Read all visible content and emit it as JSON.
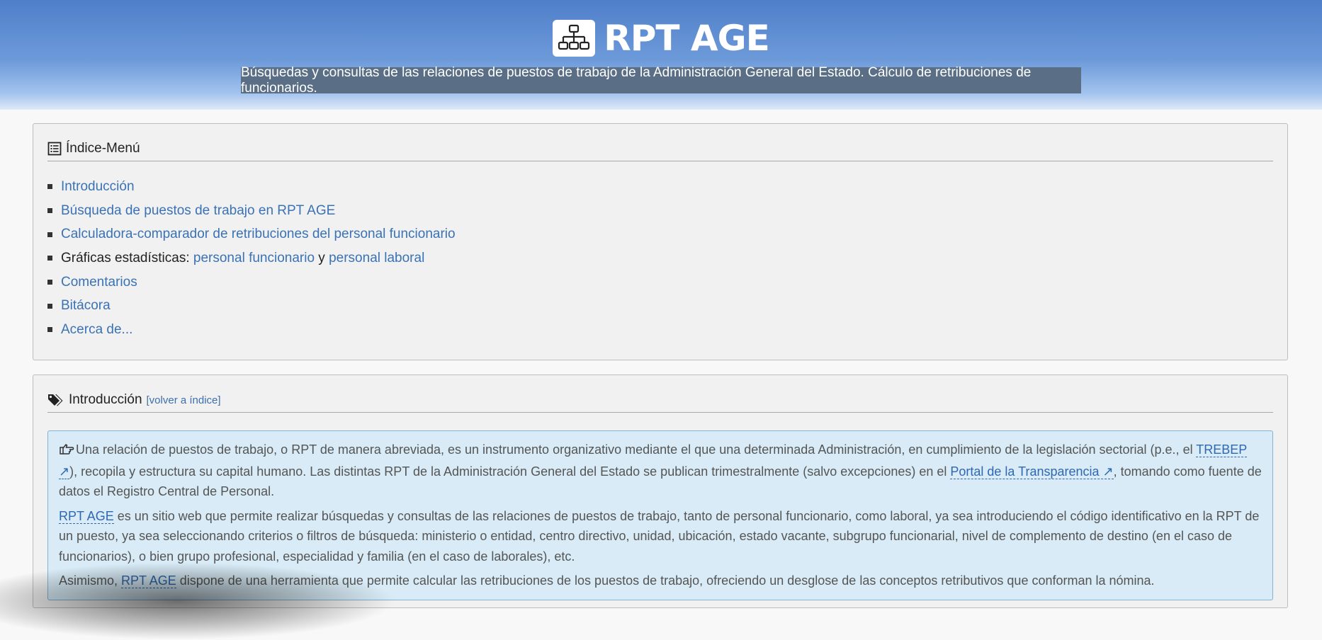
{
  "header": {
    "title": "RPT AGE",
    "subtitle": "Búsquedas y consultas de las relaciones de puestos de trabajo de la Administración General del Estado. Cálculo de retribuciones de funcionarios.",
    "logo_icon": "org-chart-icon"
  },
  "menu": {
    "title": "Índice-Menú",
    "icon": "list-icon",
    "items": [
      {
        "label": "Introducción"
      },
      {
        "label": "Búsqueda de puestos de trabajo en RPT AGE"
      },
      {
        "label": "Calculadora-comparador de retribuciones del personal funcionario"
      },
      {
        "prefix": "Gráficas estadísticas: ",
        "link1": "personal funcionario",
        "joiner": " y ",
        "link2": "personal laboral"
      },
      {
        "label": "Comentarios"
      },
      {
        "label": "Bitácora"
      },
      {
        "label": "Acerca de..."
      }
    ]
  },
  "intro": {
    "title": "Introducción",
    "icon": "tags-icon",
    "back_link": "[volver a índice]",
    "p1": {
      "icon": "hand-pointing-icon",
      "t1": "Una relación de puestos de trabajo, o RPT de manera abreviada, es un instrumento organizativo mediante el que una determinada Administración, en cumplimiento de la legislación sectorial (p.e., el ",
      "link1": "TREBEP ↗",
      "t2": "), recopila y estructura su capital humano. Las distintas RPT de la Administración General del Estado se publican trimestralmente (salvo excepciones) en el ",
      "link2": "Portal de la Transparencia ↗",
      "t3": ", tomando como fuente de datos el Registro Central de Personal."
    },
    "p2": {
      "link": "RPT AGE",
      "text": " es un sitio web que permite realizar búsquedas y consultas de las relaciones de puestos de trabajo, tanto de personal funcionario, como laboral, ya sea introduciendo el código identificativo en la RPT de un puesto, ya sea seleccionando criterios o filtros de búsqueda: ministerio o entidad, centro directivo, unidad, ubicación, estado vacante, subgrupo funcionarial, nivel de complemento de destino (en el caso de funcionarios), o bien grupo profesional, especialidad y familia (en el caso de laborales), etc."
    },
    "p3": {
      "t1": "Asimismo, ",
      "link": "RPT AGE",
      "t2": " dispone de una herramienta que permite calcular las retribuciones de los puestos de trabajo, ofreciendo un desglose de las conceptos retributivos que conforman la nómina."
    }
  }
}
